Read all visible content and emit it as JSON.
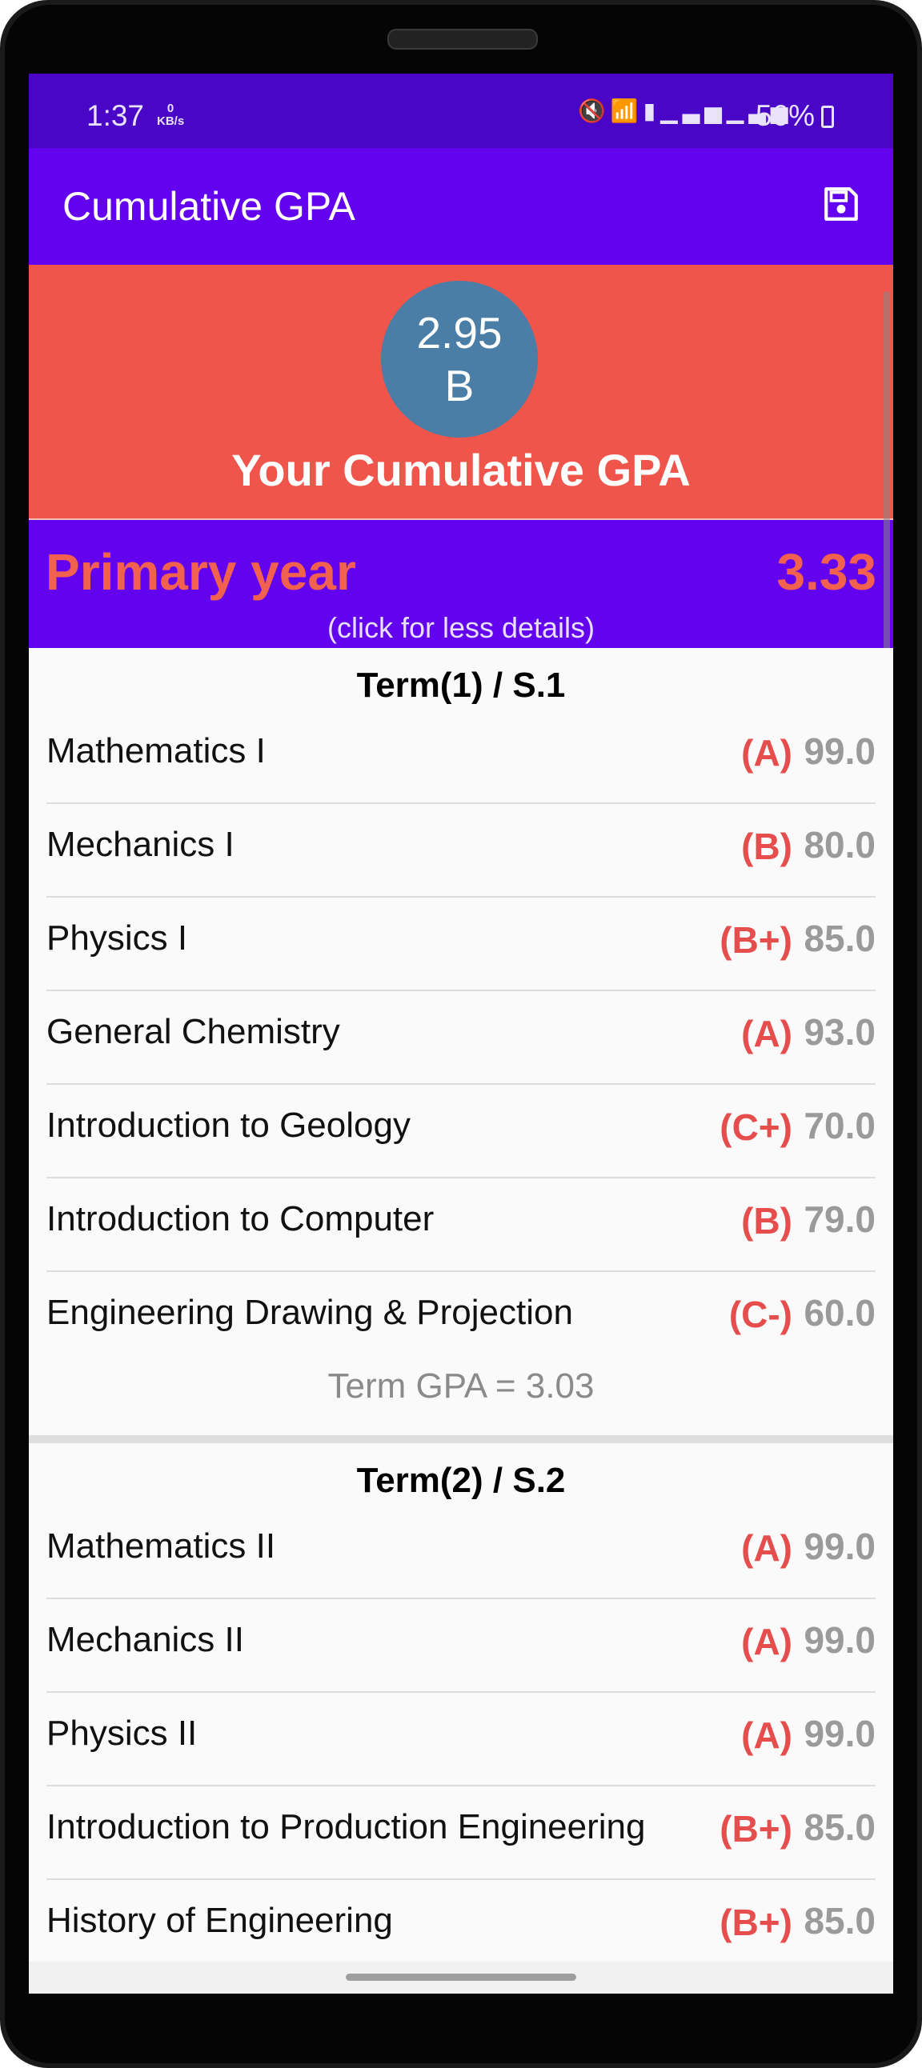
{
  "status_bar": {
    "time": "1:37",
    "net_speed_value": "0",
    "net_speed_unit": "KB/s",
    "icons": [
      "mute-icon",
      "wifi-icon",
      "volte-icon",
      "signal-icon",
      "signal-icon"
    ],
    "battery": "56%"
  },
  "app_bar": {
    "title": "Cumulative GPA",
    "save_icon": "save-icon"
  },
  "summary": {
    "gpa": "2.95",
    "letter": "B",
    "label": "Your Cumulative GPA",
    "circle_color": "#4a7ea6",
    "background_color": "#f0554b"
  },
  "year": {
    "name": "Primary year",
    "gpa": "3.33",
    "hint": "(click for less details)",
    "accent": "#6202ee",
    "highlight": "#f2604f"
  },
  "terms": [
    {
      "title": "Term(1) / S.1",
      "courses": [
        {
          "name": "Mathematics I",
          "grade": "(A)",
          "score": "99.0"
        },
        {
          "name": "Mechanics I",
          "grade": "(B)",
          "score": "80.0"
        },
        {
          "name": "Physics I",
          "grade": "(B+)",
          "score": "85.0"
        },
        {
          "name": "General Chemistry",
          "grade": "(A)",
          "score": "93.0"
        },
        {
          "name": "Introduction to Geology",
          "grade": "(C+)",
          "score": "70.0"
        },
        {
          "name": "Introduction to Computer",
          "grade": "(B)",
          "score": "79.0"
        },
        {
          "name": "Engineering Drawing & Projection",
          "grade": "(C-)",
          "score": "60.0"
        }
      ],
      "gpa_text": "Term GPA = 3.03"
    },
    {
      "title": "Term(2) / S.2",
      "courses": [
        {
          "name": "Mathematics II",
          "grade": "(A)",
          "score": "99.0"
        },
        {
          "name": "Mechanics II",
          "grade": "(A)",
          "score": "99.0"
        },
        {
          "name": "Physics II",
          "grade": "(A)",
          "score": "99.0"
        },
        {
          "name": "Introduction to Production Engineering",
          "grade": "(B+)",
          "score": "85.0"
        },
        {
          "name": "History of Engineering",
          "grade": "(B+)",
          "score": "85.0"
        }
      ]
    }
  ]
}
